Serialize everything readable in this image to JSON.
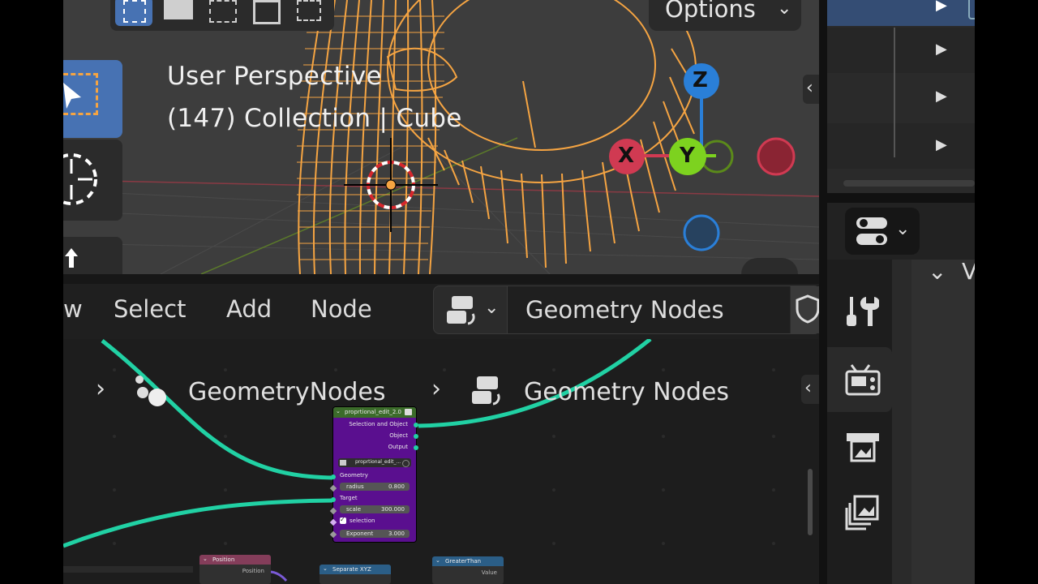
{
  "viewport": {
    "line1": "User Perspective",
    "line2": "(147) Collection | Cube",
    "options_label": "Options",
    "gizmo": {
      "z": "Z",
      "x": "X",
      "y": "Y"
    }
  },
  "node_editor_header": {
    "menu_partial": "w",
    "select_label": "Select",
    "add_label": "Add",
    "node_label": "Node",
    "tree_name": "Geometry Nodes"
  },
  "breadcrumb": {
    "object_modifier": "GeometryNodes",
    "node_tree": "Geometry Nodes"
  },
  "group_node": {
    "title": "proprtional_edit_2.0",
    "outputs": [
      "Selection and Object",
      "Object",
      "Output"
    ],
    "group_selector_value": "proprtional_edit_...",
    "inputs": {
      "geometry": "Geometry",
      "radius_label": "radius",
      "radius_value": "0.800",
      "target": "Target",
      "scale_label": "scale",
      "scale_value": "300.000",
      "selection_label": "selection",
      "exponent_label": "Exponent",
      "exponent_value": "3.000"
    }
  },
  "bottom_nodes": {
    "position_title": "Position",
    "position_out": "Position",
    "separate_title": "Separate XYZ",
    "greater_title": "GreaterThan",
    "greater_out": "Value"
  },
  "colors": {
    "accent_blue": "#4772b3",
    "wire_orange": "#f5a442",
    "noodle_teal": "#21d1a4",
    "group_node_purple": "#5a0f8f",
    "axis_x": "#d03a52",
    "axis_y": "#7dd21f",
    "axis_z": "#2a7fd8"
  }
}
